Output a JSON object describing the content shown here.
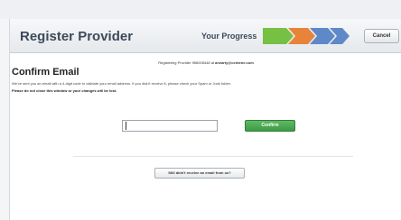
{
  "header": {
    "title": "Register Provider",
    "progress_label": "Your Progress",
    "cancel_label": "Cancel",
    "steps": [
      {
        "color": "#76c043"
      },
      {
        "color": "#e8833a"
      },
      {
        "color": "#5f88c9"
      },
      {
        "color": "#5f88c9"
      }
    ]
  },
  "main": {
    "registering_prefix": "Registering Provider 956005448 at ",
    "registering_email": "anearty@centene.com",
    "heading": "Confirm Email",
    "body": "We've sent you an email with a 4-digit code to validate your email address. If you didn't receive it, please check your Spam or Junk folder.",
    "warning": "Please do not close this window or your changes will be lost.",
    "code_value": "",
    "confirm_label": "Confirm",
    "resend_label": "Still didn't receive an email from us?"
  }
}
